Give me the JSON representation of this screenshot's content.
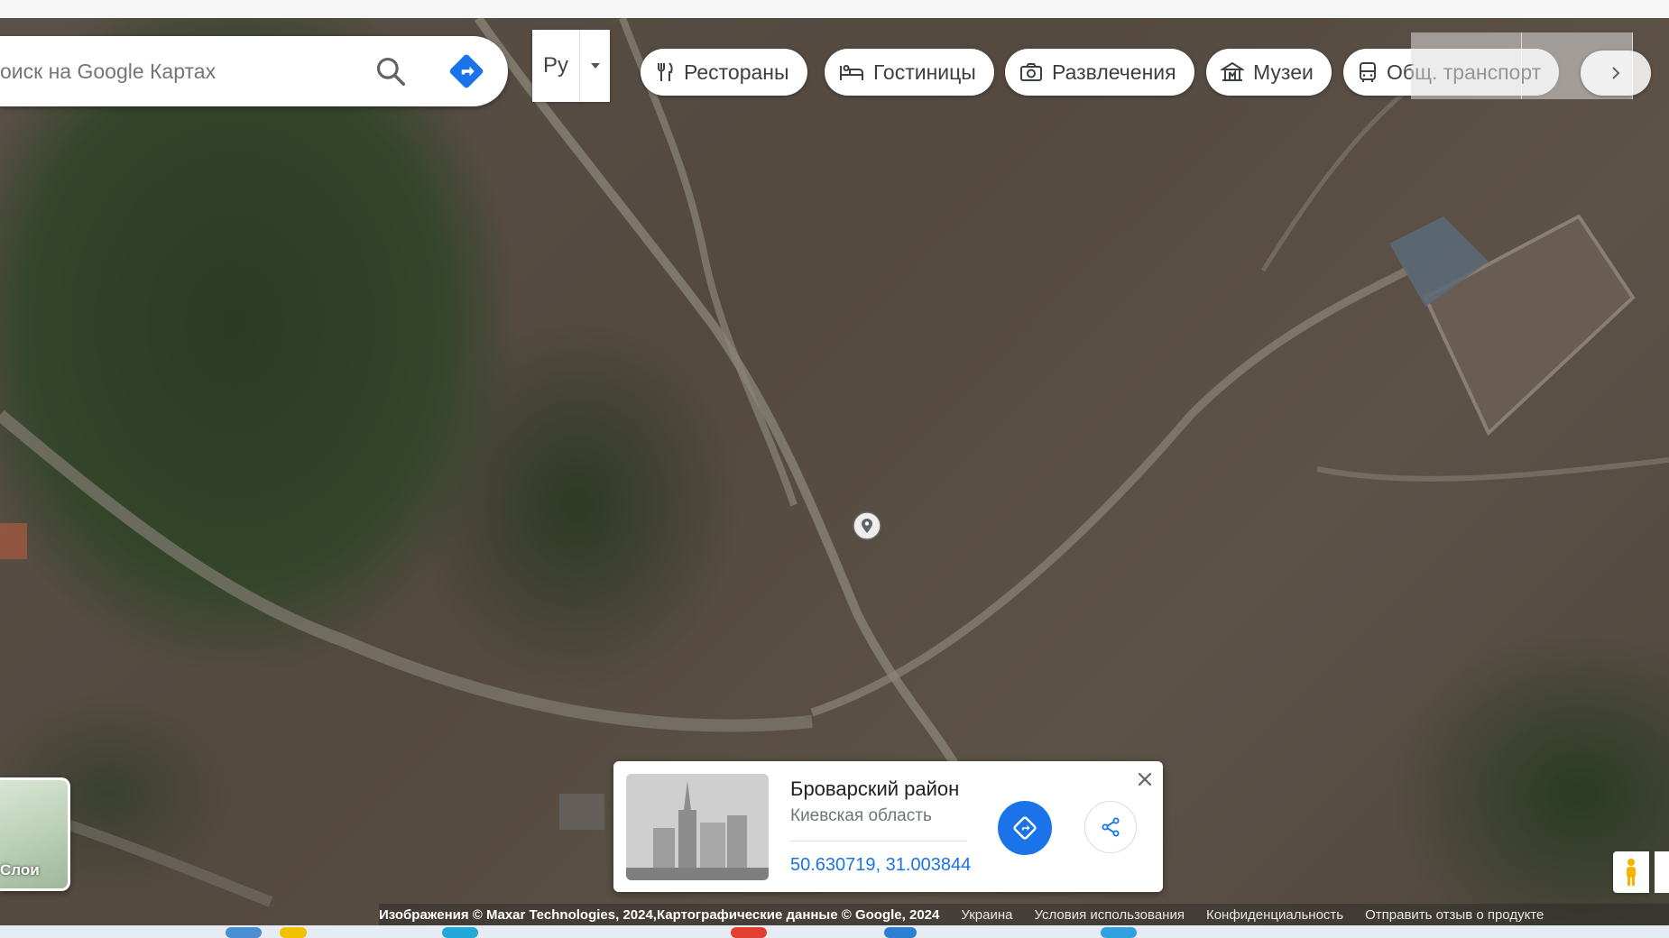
{
  "search": {
    "placeholder": "оиск на Google Картах"
  },
  "language": {
    "label": "Ру"
  },
  "chips": [
    {
      "label": "Рестораны",
      "icon": "fork-knife-icon"
    },
    {
      "label": "Гостиницы",
      "icon": "bed-icon"
    },
    {
      "label": "Развлечения",
      "icon": "camera-icon"
    },
    {
      "label": "Музеи",
      "icon": "museum-icon"
    },
    {
      "label": "Общ. транспорт",
      "icon": "bus-icon"
    }
  ],
  "place_card": {
    "title": "Броварский район",
    "subtitle": "Киевская область",
    "coordinates": "50.630719, 31.003844"
  },
  "layers": {
    "label": "Слои"
  },
  "attribution": {
    "imagery": "Изображения © Maxar Technologies, 2024,Картографические данные © Google, 2024",
    "country": "Украина",
    "terms": "Условия использования",
    "privacy": "Конфиденциальность",
    "feedback": "Отправить отзыв о продукте"
  },
  "colors": {
    "accent": "#1a73e8",
    "chip_text": "#3c4043"
  }
}
